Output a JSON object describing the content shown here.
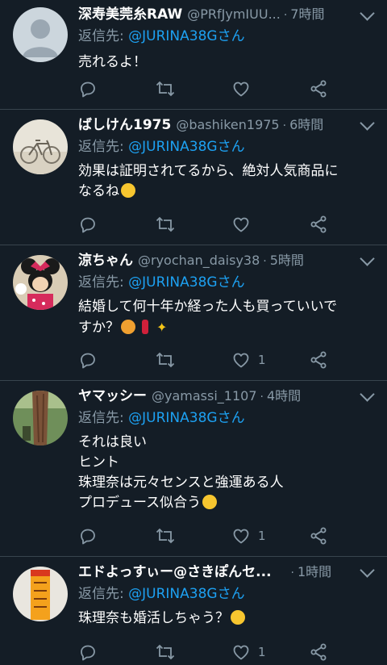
{
  "tweets": [
    {
      "name": "深寿美莞糸RAW",
      "handle": "@PRfJymIUU...",
      "dot": "·",
      "time": "7時間",
      "reply_prefix": "返信先:",
      "reply_to": "@JURINA38Gさん",
      "lines": [
        "売れるよ！"
      ],
      "like_count": "",
      "avatar": "default-avatar-icon"
    },
    {
      "name": "ばしけん1975",
      "handle": "@bashiken1975",
      "dot": "·",
      "time": "6時間",
      "reply_prefix": "返信先:",
      "reply_to": "@JURINA38Gさん",
      "lines": [
        "効果は証明されてるから、絶対人気商品に",
        "なるね"
      ],
      "like_count": "",
      "avatar": "bicycle-photo"
    },
    {
      "name": "涼ちゃん",
      "handle": "@ryochan_daisy38",
      "dot": "·",
      "time": "5時間",
      "reply_prefix": "返信先:",
      "reply_to": "@JURINA38Gさん",
      "lines": [
        "結婚して何十年か経った人も買っていいで",
        "すか？"
      ],
      "like_count": "1",
      "avatar": "minnie-photo"
    },
    {
      "name": "ヤマッシー",
      "handle": "@yamassi_1107",
      "dot": "·",
      "time": "4時間",
      "reply_prefix": "返信先:",
      "reply_to": "@JURINA38Gさん",
      "lines": [
        "それは良い",
        "ヒント",
        "珠理奈は元々センスと強運ある人",
        "プロデュース似合う"
      ],
      "like_count": "1",
      "avatar": "tree-photo"
    },
    {
      "name": "エドよっすぃー@さきぽんセ...",
      "handle": "",
      "dot": "·",
      "time": "1時間",
      "reply_prefix": "返信先:",
      "reply_to": "@JURINA38Gさん",
      "lines": [
        "珠理奈も婚活しちゃう？"
      ],
      "like_count": "1",
      "avatar": "orange-photo"
    }
  ],
  "colors": {
    "background": "#141d26",
    "secondary_text": "#8899a6",
    "mention": "#1da1f2",
    "divider": "#38444d"
  }
}
